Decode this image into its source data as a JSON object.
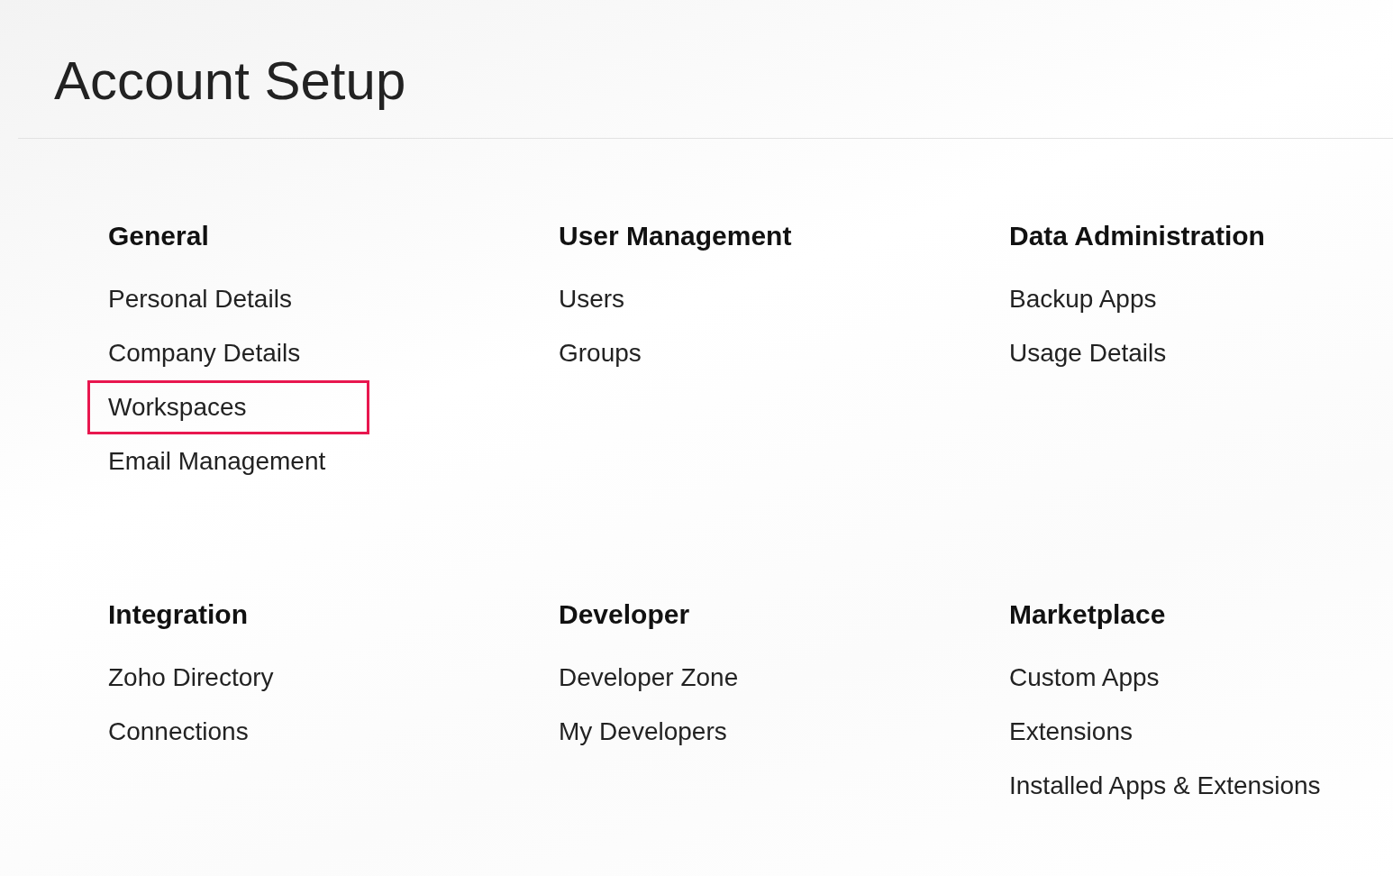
{
  "page": {
    "title": "Account Setup"
  },
  "sections": [
    {
      "heading": "General",
      "items": [
        {
          "label": "Personal Details",
          "highlighted": false
        },
        {
          "label": "Company Details",
          "highlighted": false
        },
        {
          "label": "Workspaces",
          "highlighted": true
        },
        {
          "label": "Email Management",
          "highlighted": false
        }
      ]
    },
    {
      "heading": "User Management",
      "items": [
        {
          "label": "Users",
          "highlighted": false
        },
        {
          "label": "Groups",
          "highlighted": false
        }
      ]
    },
    {
      "heading": "Data Administration",
      "items": [
        {
          "label": "Backup Apps",
          "highlighted": false
        },
        {
          "label": "Usage Details",
          "highlighted": false
        }
      ]
    },
    {
      "heading": "Integration",
      "items": [
        {
          "label": "Zoho Directory",
          "highlighted": false
        },
        {
          "label": "Connections",
          "highlighted": false
        }
      ]
    },
    {
      "heading": "Developer",
      "items": [
        {
          "label": "Developer Zone",
          "highlighted": false
        },
        {
          "label": "My Developers",
          "highlighted": false
        }
      ]
    },
    {
      "heading": "Marketplace",
      "items": [
        {
          "label": "Custom Apps",
          "highlighted": false
        },
        {
          "label": "Extensions",
          "highlighted": false
        },
        {
          "label": "Installed Apps & Extensions",
          "highlighted": false
        }
      ]
    }
  ]
}
